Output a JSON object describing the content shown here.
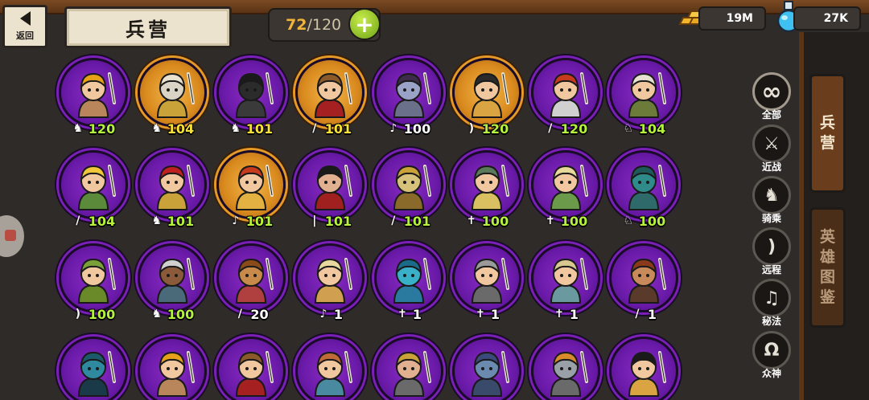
{
  "header": {
    "back_label": "返回",
    "title": "兵营",
    "capacity_current": "72",
    "capacity_sep": "/",
    "capacity_max": "120",
    "plus_label": "+",
    "gold": "19M",
    "potion": "27K"
  },
  "filters": [
    {
      "icon": "infinity-icon",
      "symbol": "∞",
      "label": "全部"
    },
    {
      "icon": "sword-icon",
      "symbol": "⚔",
      "label": "近战"
    },
    {
      "icon": "horse-head-icon",
      "symbol": "♞",
      "label": "骑乘"
    },
    {
      "icon": "bow-icon",
      "symbol": ")",
      "label": "远程"
    },
    {
      "icon": "magic-note-icon",
      "symbol": "♫",
      "label": "秘法"
    },
    {
      "icon": "omega-icon",
      "symbol": "Ω",
      "label": "众神"
    }
  ],
  "side_tabs": {
    "barracks": [
      "兵",
      "营"
    ],
    "heroes": [
      "英",
      "雄",
      "图",
      "鉴"
    ]
  },
  "units": [
    {
      "level": "120",
      "type": "mounted",
      "frame": "purple",
      "color_level": "lime",
      "skin": "#f1c7a0",
      "hair": "#e5a218",
      "armor": "#b8865a"
    },
    {
      "level": "104",
      "type": "mounted",
      "frame": "gold",
      "color_level": "yellow",
      "skin": "#d9d4c6",
      "hair": "#e8e2cf",
      "armor": "#c9a23a"
    },
    {
      "level": "101",
      "type": "mounted",
      "frame": "purple",
      "color_level": "yellow",
      "skin": "#2b2b2b",
      "hair": "#1a1a1a",
      "armor": "#3a3a3a"
    },
    {
      "level": "101",
      "type": "melee",
      "frame": "gold",
      "color_level": "yellow",
      "skin": "#f1c7a0",
      "hair": "#8a5a2b",
      "armor": "#a52020"
    },
    {
      "level": "100",
      "type": "magic",
      "frame": "purple",
      "color_level": "white",
      "skin": "#9aa2c8",
      "hair": "#3d2b4a",
      "armor": "#6a6f8a"
    },
    {
      "level": "120",
      "type": "ranged",
      "frame": "gold",
      "color_level": "lime",
      "skin": "#f1c7a0",
      "hair": "#2b2b2b",
      "armor": "#d9a441"
    },
    {
      "level": "120",
      "type": "melee",
      "frame": "purple",
      "color_level": "lime",
      "skin": "#f1c7a0",
      "hair": "#c63a1d",
      "armor": "#d0d0d0"
    },
    {
      "level": "104",
      "type": "mounted2",
      "frame": "purple",
      "color_level": "lime",
      "skin": "#f1c7a0",
      "hair": "#e5e0d0",
      "armor": "#6c7a3a"
    },
    {
      "level": "104",
      "type": "melee",
      "frame": "purple",
      "color_level": "lime",
      "skin": "#f1c7a0",
      "hair": "#f0c63a",
      "armor": "#5a8a3a"
    },
    {
      "level": "101",
      "type": "mounted",
      "frame": "purple",
      "color_level": "lime",
      "skin": "#f1c7a0",
      "hair": "#c02020",
      "armor": "#c9a23a"
    },
    {
      "level": "101",
      "type": "magic",
      "frame": "gold",
      "color_level": "lime",
      "skin": "#f1c7a0",
      "hair": "#c63a1d",
      "armor": "#e3b042"
    },
    {
      "level": "101",
      "type": "dagger",
      "frame": "purple",
      "color_level": "lime",
      "skin": "#e0b090",
      "hair": "#1a1a1a",
      "armor": "#a02020"
    },
    {
      "level": "101",
      "type": "melee",
      "frame": "purple",
      "color_level": "lime",
      "skin": "#d6c27a",
      "hair": "#c9a23a",
      "armor": "#8a6a2a"
    },
    {
      "level": "100",
      "type": "holy",
      "frame": "purple",
      "color_level": "lime",
      "skin": "#f1c7a0",
      "hair": "#5a7a5a",
      "armor": "#d9c060"
    },
    {
      "level": "100",
      "type": "holy",
      "frame": "purple",
      "color_level": "lime",
      "skin": "#f1c7a0",
      "hair": "#e8d89a",
      "armor": "#6a9a4a"
    },
    {
      "level": "100",
      "type": "mounted2",
      "frame": "purple",
      "color_level": "lime",
      "skin": "#2f8a8a",
      "hair": "#1e5a5a",
      "armor": "#2f6a6a"
    },
    {
      "level": "100",
      "type": "ranged",
      "frame": "purple",
      "color_level": "lime",
      "skin": "#f1c7a0",
      "hair": "#7aa03a",
      "armor": "#6a8a2a"
    },
    {
      "level": "100",
      "type": "mounted",
      "frame": "purple",
      "color_level": "lime",
      "skin": "#8a5a3a",
      "hair": "#d0d0d0",
      "armor": "#4a6a7a"
    },
    {
      "level": "20",
      "type": "melee",
      "frame": "purple",
      "color_level": "white",
      "skin": "#c88a4a",
      "hair": "#8a4a1a",
      "armor": "#b04040"
    },
    {
      "level": "1",
      "type": "magic",
      "frame": "purple",
      "color_level": "white",
      "skin": "#f1c7a0",
      "hair": "#e8d8a0",
      "armor": "#d0a050"
    },
    {
      "level": "1",
      "type": "holy",
      "frame": "purple",
      "color_level": "white",
      "skin": "#3ab0c8",
      "hair": "#1a6a8a",
      "armor": "#2a7aa0"
    },
    {
      "level": "1",
      "type": "holy",
      "frame": "purple",
      "color_level": "white",
      "skin": "#f1c7a0",
      "hair": "#9a9a9a",
      "armor": "#6a6a6a"
    },
    {
      "level": "1",
      "type": "holy",
      "frame": "purple",
      "color_level": "white",
      "skin": "#f1c7a0",
      "hair": "#d8c890",
      "armor": "#6a9aa0"
    },
    {
      "level": "1",
      "type": "melee",
      "frame": "purple",
      "color_level": "white",
      "skin": "#c88a5a",
      "hair": "#8a3a1a",
      "armor": "#5a3a2a"
    },
    {
      "level": "",
      "type": "",
      "frame": "purple",
      "color_level": "white",
      "skin": "#2f8aa0",
      "hair": "#1a5a6a",
      "armor": "#1a3a4a"
    },
    {
      "level": "",
      "type": "",
      "frame": "purple",
      "color_level": "white",
      "skin": "#f1c7a0",
      "hair": "#e5a218",
      "armor": "#b8865a"
    },
    {
      "level": "",
      "type": "",
      "frame": "purple",
      "color_level": "white",
      "skin": "#f1c7a0",
      "hair": "#8a5a2b",
      "armor": "#a52020"
    },
    {
      "level": "",
      "type": "",
      "frame": "purple",
      "color_level": "white",
      "skin": "#f1c7a0",
      "hair": "#c06a3a",
      "armor": "#4a8aa0"
    },
    {
      "level": "",
      "type": "",
      "frame": "purple",
      "color_level": "white",
      "skin": "#e0b090",
      "hair": "#c9a23a",
      "armor": "#6a6a6a"
    },
    {
      "level": "",
      "type": "",
      "frame": "purple",
      "color_level": "white",
      "skin": "#6a8ab0",
      "hair": "#3a4a7a",
      "armor": "#3a4a6a"
    },
    {
      "level": "",
      "type": "",
      "frame": "purple",
      "color_level": "white",
      "skin": "#9aa0a8",
      "hair": "#d98a2a",
      "armor": "#6a6a6a"
    },
    {
      "level": "",
      "type": "",
      "frame": "purple",
      "color_level": "white",
      "skin": "#f1c7a0",
      "hair": "#1a1a1a",
      "armor": "#d9a441"
    }
  ]
}
